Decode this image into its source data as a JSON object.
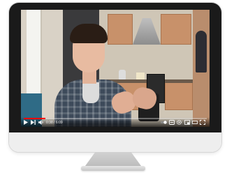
{
  "video": {
    "player": "youtube-style",
    "progress_percent": 12,
    "time_text": "0:38 / 6:09"
  },
  "colors": {
    "bezel": "#1a1a1a",
    "chin": "#eeeeee",
    "progress": "#ff0000"
  },
  "icons": {
    "play": "play-icon",
    "next": "next-icon",
    "volume": "volume-icon",
    "autoplay": "autoplay-toggle-icon",
    "captions": "captions-icon",
    "settings": "gear-icon",
    "miniplayer": "miniplayer-icon",
    "theater": "theater-icon",
    "fullscreen": "fullscreen-icon"
  }
}
